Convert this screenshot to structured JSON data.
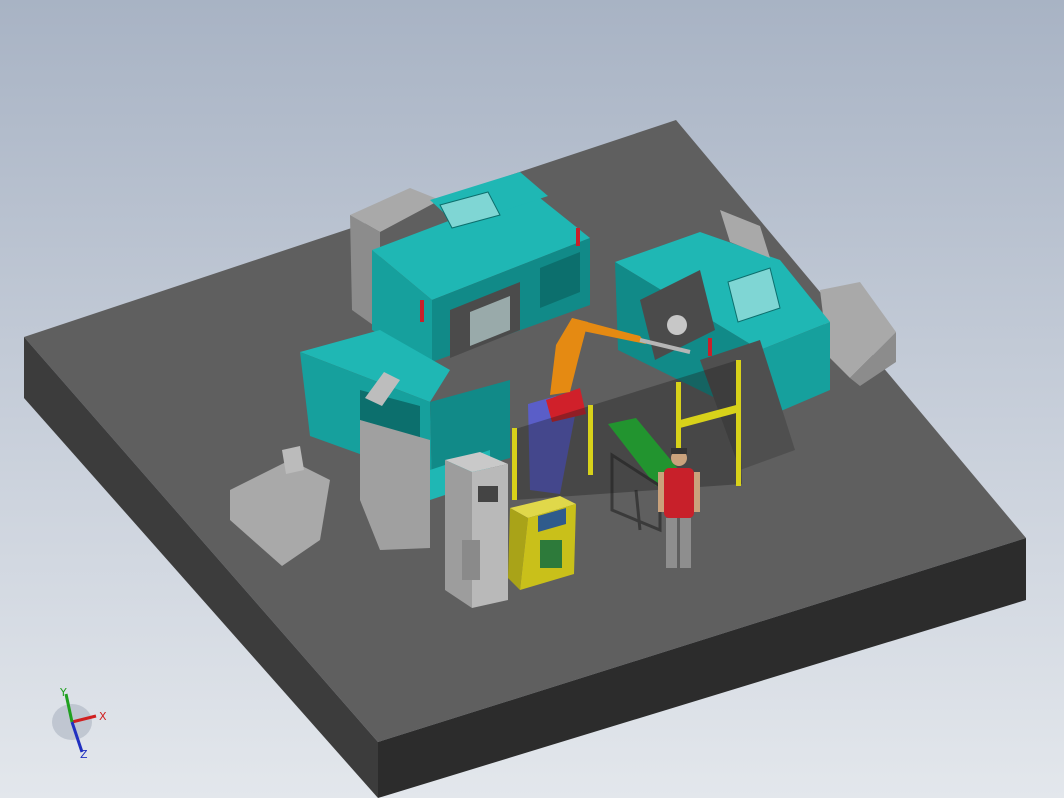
{
  "viewport": {
    "background_top": "#a8b3c4",
    "background_bottom": "#e3e7ec"
  },
  "scene": {
    "colors": {
      "platform_top": "#5f5f5f",
      "platform_side_left": "#3e3e3e",
      "platform_side_front": "#2f2f2f",
      "machine_teal": "#1fb7b4",
      "machine_teal_dark": "#118a88",
      "machine_grey": "#a9a9a9",
      "robot_orange": "#e58a12",
      "robot_blue": "#5a5ec8",
      "gripper_red": "#d0202a",
      "fence_yellow": "#d8d21a",
      "conveyor_green": "#26d43a",
      "console_yellow": "#c9c01a",
      "operator_shirt": "#c8202a"
    },
    "icons": {
      "beacon": "stack-light-icon",
      "operator": "human-figure-icon"
    }
  },
  "triad": {
    "x_label": "X",
    "y_label": "Y",
    "z_label": "Z",
    "x_color": "#d02020",
    "y_color": "#20a020",
    "z_color": "#2030c0"
  }
}
